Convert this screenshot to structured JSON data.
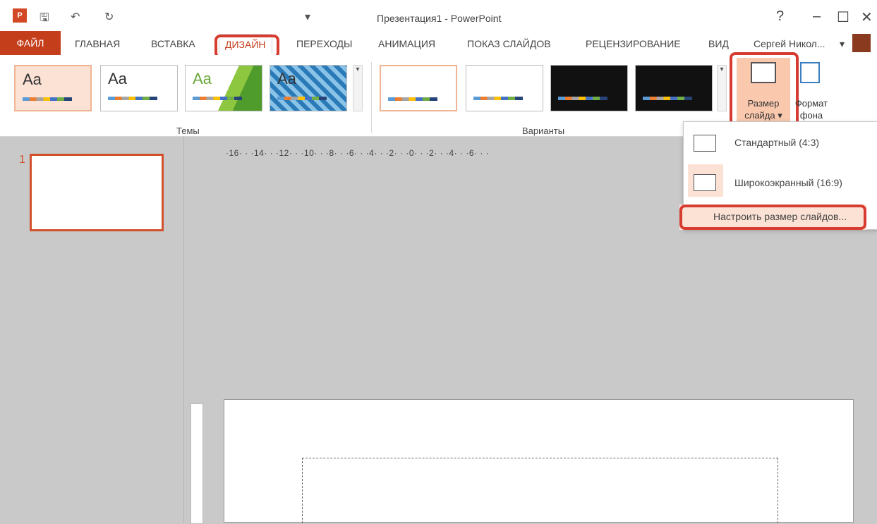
{
  "window": {
    "title": "Презентация1 - PowerPoint",
    "app_badge": "P",
    "help": "?",
    "minimize": "–",
    "maximize": "☐",
    "close": "✕"
  },
  "quick_access": {
    "save": "🖫",
    "undo": "↶",
    "redo": "↻",
    "dropdown": "▾"
  },
  "tabs": [
    "ФАЙЛ",
    "ГЛАВНАЯ",
    "ВСТАВКА",
    "ДИЗАЙН",
    "ПЕРЕХОДЫ",
    "АНИМАЦИЯ",
    "ПОКАЗ СЛАЙДОВ",
    "РЕЦЕНЗИРОВАНИЕ",
    "ВИД"
  ],
  "active_tab": "ДИЗАЙН",
  "user": {
    "name": "Сергей Никол...",
    "caret": "▾"
  },
  "ribbon": {
    "themes_label": "Темы",
    "theme_sample": "Aa",
    "variants_label": "Варианты",
    "slide_size_button": [
      "Размер",
      "слайда ▾"
    ],
    "format_background_button": [
      "Формат",
      "фона"
    ],
    "scroll_up": "▲",
    "scroll_down": "▼",
    "scroll_more": "▾"
  },
  "slide_size_menu": {
    "standard": "Стандартный (4:3)",
    "widescreen": "Широкоэкранный (16:9)",
    "custom": "Настроить размер слайдов..."
  },
  "slides": {
    "thumbnail_number": "1"
  },
  "ruler_text": "·16· · ·14· · ·12· · ·10· · ·8· · ·6· · ·4· · ·2· · ·0· · ·2· · ·4· · ·6· · ·",
  "accent_color": "#c43e1c",
  "callout_color": "#d73c30"
}
